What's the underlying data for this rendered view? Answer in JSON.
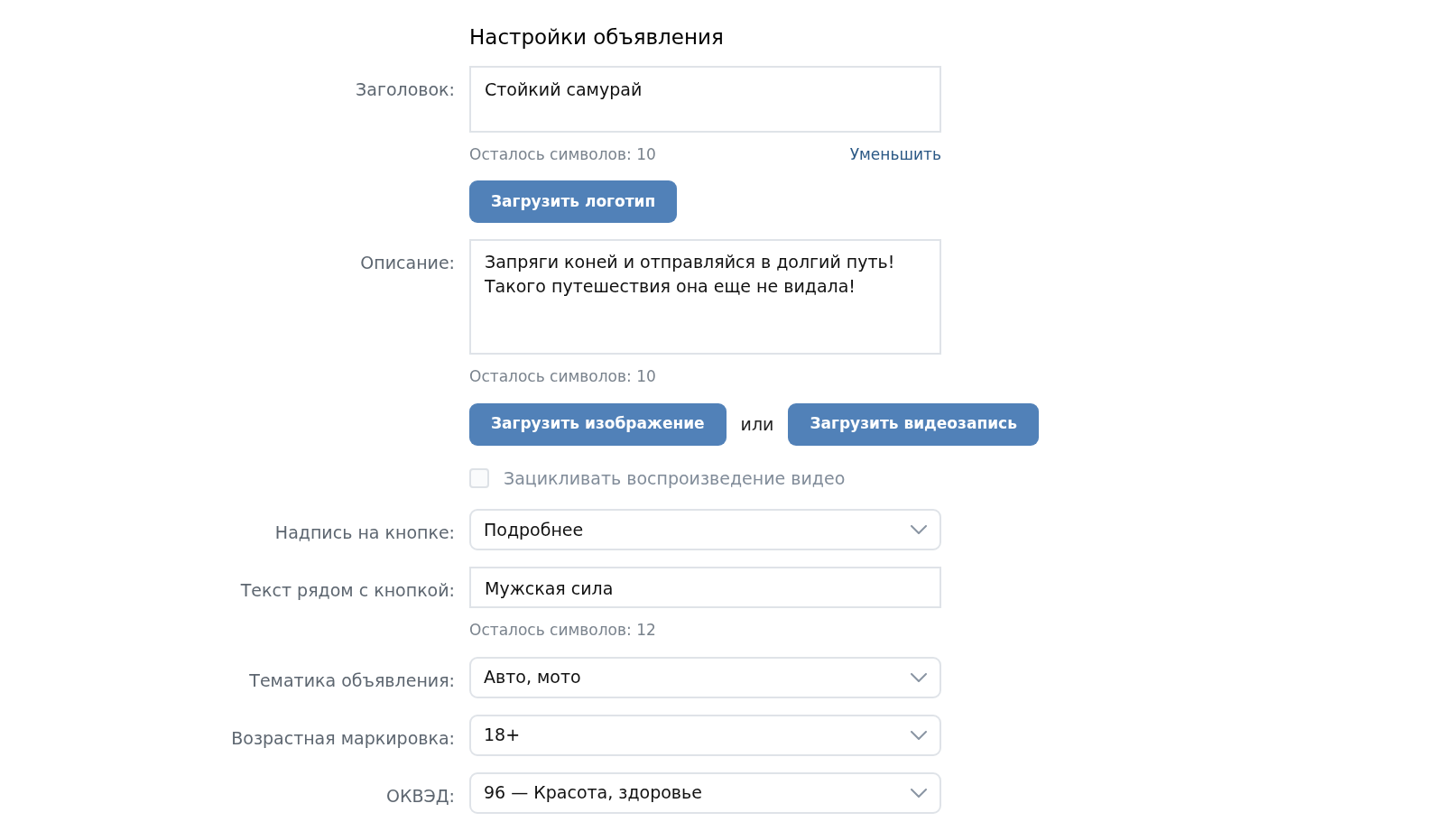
{
  "title": "Настройки объявления",
  "rows": [
    {
      "kind": "headline",
      "label": "Заголовок:",
      "value": "Стойкий самурай",
      "hint": "Осталось символов: 10",
      "link": "Уменьшить"
    },
    {
      "kind": "buttons",
      "buttons": [
        "Загрузить логотип"
      ]
    },
    {
      "kind": "description",
      "label": "Описание:",
      "value": "Запряги коней и отправляйся в долгий путь!\nТакого путешествия она еще не видала!",
      "hint": "Осталось символов: 10"
    },
    {
      "kind": "buttons",
      "buttons": [
        "Загрузить изображение",
        "Загрузить видеозапись"
      ],
      "separator": "или"
    },
    {
      "kind": "checkbox",
      "label": "Зацикливать воспроизведение видео",
      "checked": false,
      "disabled": true
    },
    {
      "kind": "select",
      "label": "Надпись на кнопке:",
      "value": "Подробнее"
    },
    {
      "kind": "input",
      "label": "Текст рядом с кнопкой:",
      "value": "Мужская сила",
      "hint": "Осталось символов: 12"
    },
    {
      "kind": "select",
      "label": "Тематика объявления:",
      "value": "Авто, мото"
    },
    {
      "kind": "select",
      "label": "Возрастная маркировка:",
      "value": "18+"
    },
    {
      "kind": "select",
      "label": "ОКВЭД:",
      "value": "96 — Красота, здоровье"
    }
  ]
}
